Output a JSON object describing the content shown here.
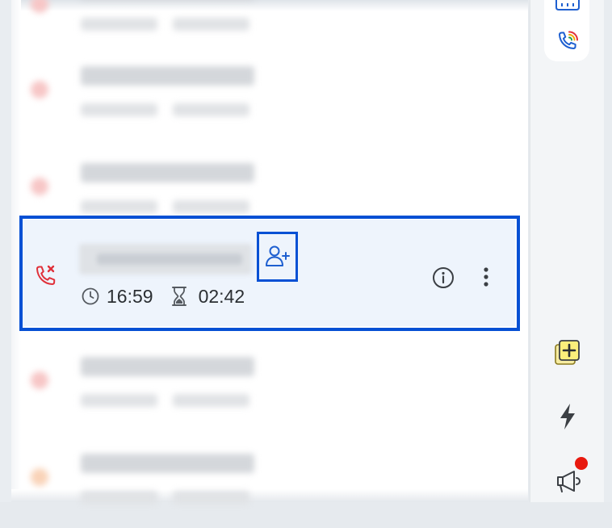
{
  "highlighted_call": {
    "type": "missed",
    "time": "16:59",
    "duration": "02:42"
  },
  "colors": {
    "highlight_border": "#0650d4",
    "missed_call": "#e0303a",
    "accent_blue": "#1e5fd0",
    "notification_dot": "#e8190f"
  },
  "sidebar": {
    "items": [
      {
        "name": "dialpad-icon"
      },
      {
        "name": "call-history-icon"
      },
      {
        "name": "notes-icon"
      },
      {
        "name": "quick-actions-icon"
      },
      {
        "name": "announcements-icon",
        "has_notification": true
      }
    ]
  }
}
